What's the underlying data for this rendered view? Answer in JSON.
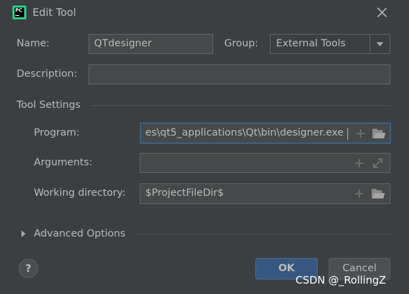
{
  "window": {
    "title": "Edit Tool",
    "app_icon": "pycharm-icon",
    "close_icon": "close-icon"
  },
  "form": {
    "name_label": "Name:",
    "name_value": "QTdesigner",
    "group_label": "Group:",
    "group_value": "External Tools",
    "description_label": "Description:",
    "description_value": ""
  },
  "tool_settings": {
    "section_title": "Tool Settings",
    "program_label": "Program:",
    "program_value": "es\\qt5_applications\\Qt\\bin\\designer.exe",
    "arguments_label": "Arguments:",
    "arguments_value": "",
    "working_dir_label": "Working directory:",
    "working_dir_value": "$ProjectFileDir$"
  },
  "advanced": {
    "label": "Advanced Options"
  },
  "buttons": {
    "help": "?",
    "ok": "OK",
    "cancel": "Cancel"
  },
  "watermark": "CSDN @_RollingZ",
  "colors": {
    "background": "#3c3f41",
    "field_bg": "#45494a",
    "focus_border": "#3d6185",
    "ok_button": "#365880"
  }
}
